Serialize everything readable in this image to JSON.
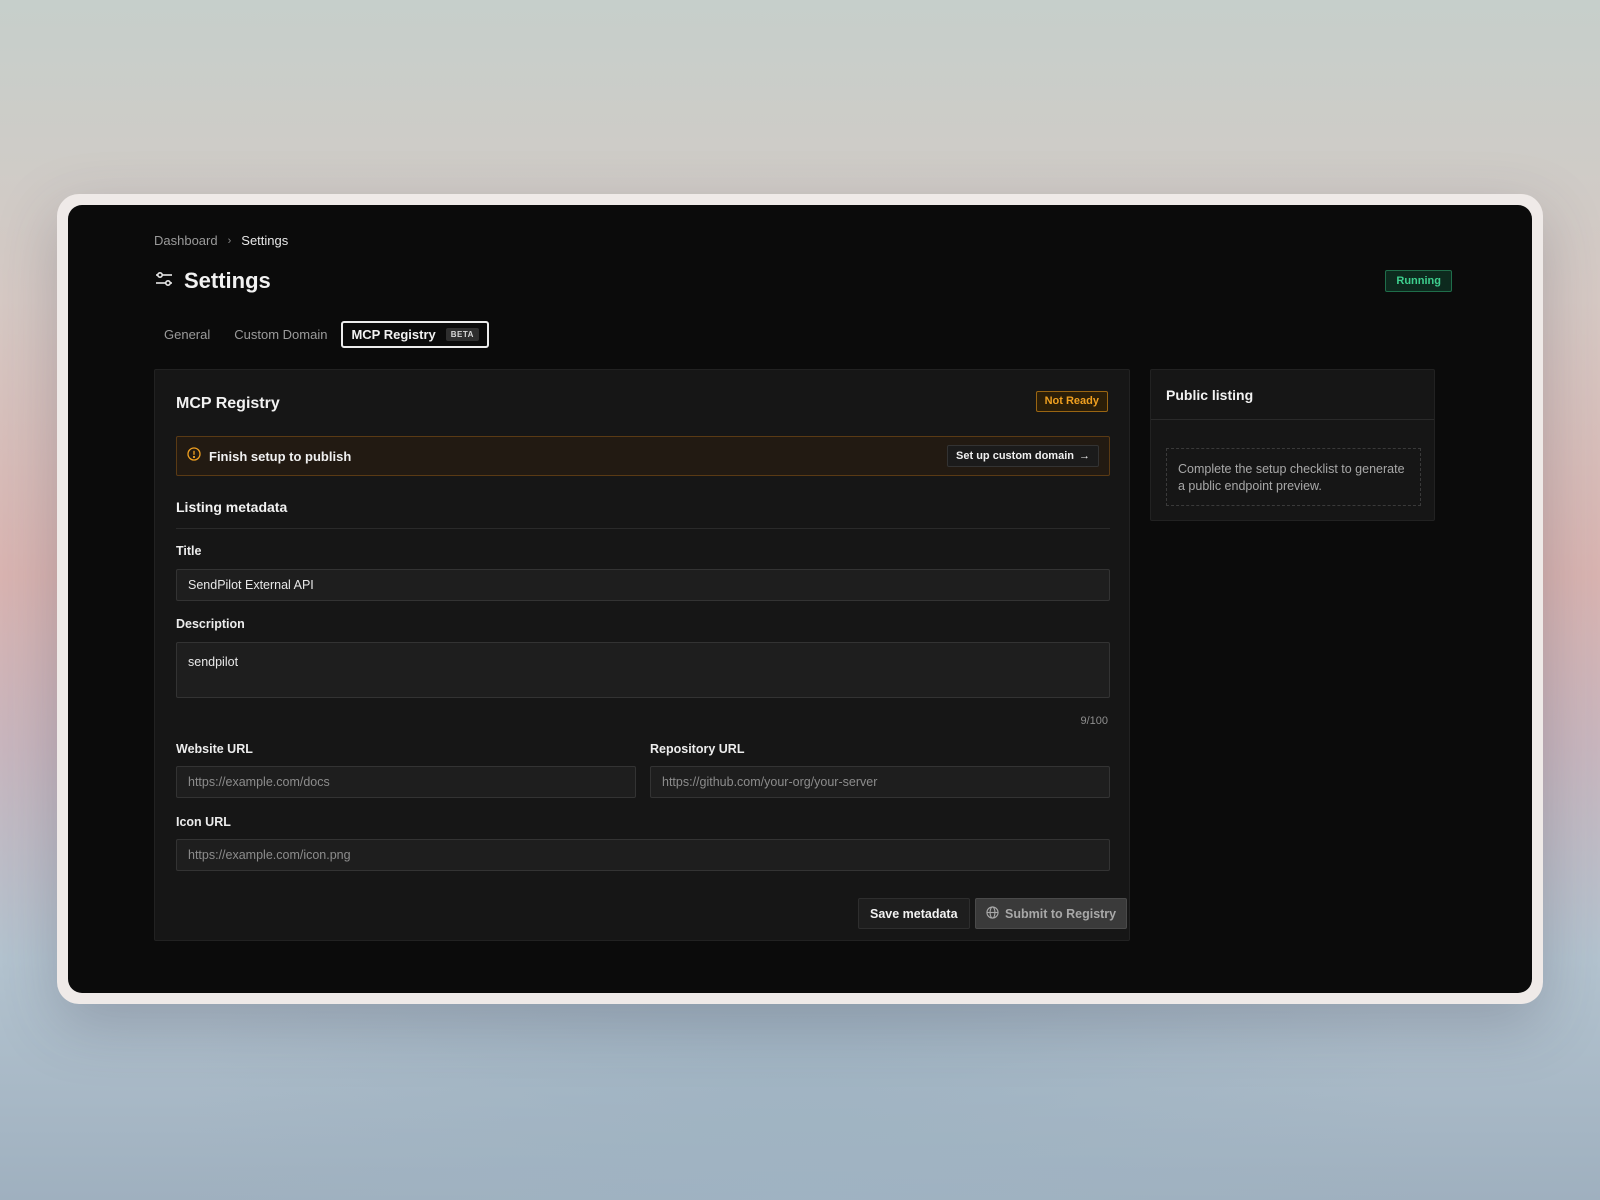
{
  "breadcrumb": {
    "parent": "Dashboard",
    "current": "Settings"
  },
  "page": {
    "title": "Settings",
    "status": "Running"
  },
  "tabs": [
    {
      "label": "General"
    },
    {
      "label": "Custom Domain"
    },
    {
      "label": "MCP Registry",
      "badge": "BETA",
      "active": true
    }
  ],
  "registry": {
    "title": "MCP Registry",
    "status_badge": "Not Ready",
    "alert": {
      "text": "Finish setup to publish",
      "action": "Set up custom domain"
    },
    "section_title": "Listing metadata",
    "fields": {
      "title": {
        "label": "Title",
        "value": "SendPilot External API"
      },
      "description": {
        "label": "Description",
        "value": "sendpilot",
        "counter": "9/100"
      },
      "website": {
        "label": "Website URL",
        "placeholder": "https://example.com/docs"
      },
      "repository": {
        "label": "Repository URL",
        "placeholder": "https://github.com/your-org/your-server"
      },
      "icon": {
        "label": "Icon URL",
        "placeholder": "https://example.com/icon.png"
      }
    },
    "actions": {
      "save": "Save metadata",
      "submit": "Submit to Registry"
    }
  },
  "public_listing": {
    "title": "Public listing",
    "empty_text": "Complete the setup checklist to generate a public endpoint preview."
  },
  "colors": {
    "running": "#3ecf8e",
    "not_ready": "#f0a020",
    "window_bg": "#0b0b0b",
    "card_bg": "#161616"
  },
  "icons": [
    "settings-sliders-icon",
    "chevron-right-icon",
    "warning-circle-icon",
    "arrow-right-icon",
    "globe-icon"
  ]
}
